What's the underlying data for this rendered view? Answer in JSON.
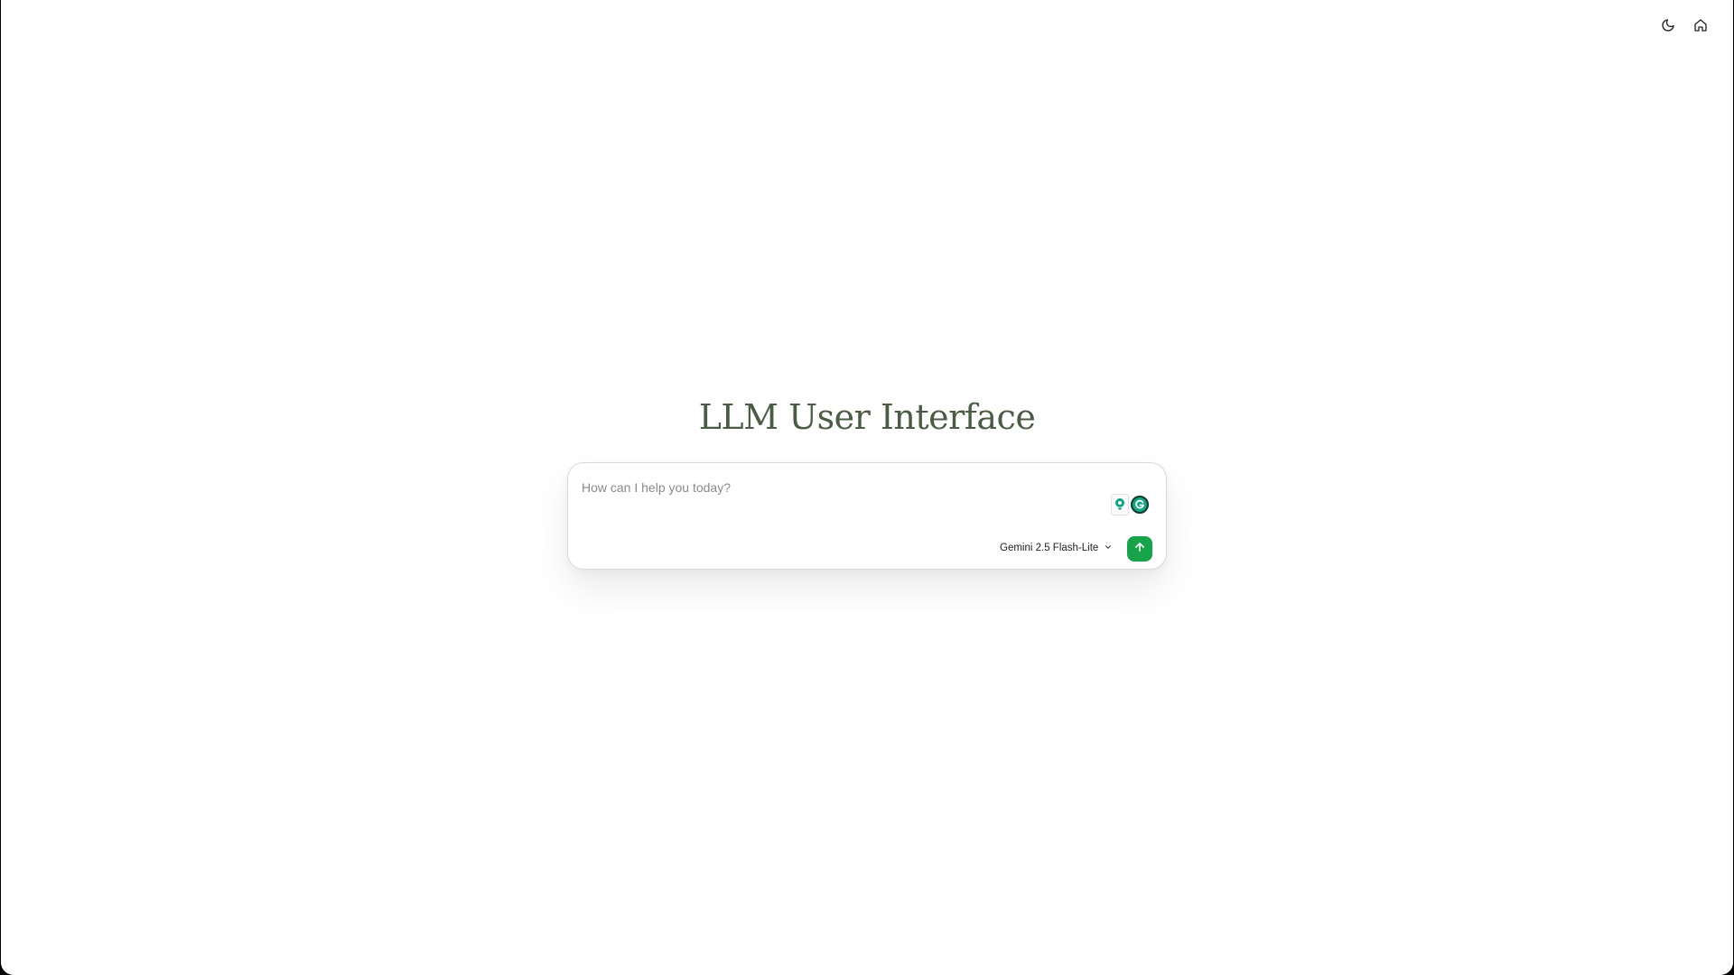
{
  "header": {
    "theme_toggle_icon": "moon-icon",
    "home_icon": "home-icon"
  },
  "main": {
    "title": "LLM User Interface"
  },
  "composer": {
    "placeholder": "How can I help you today?",
    "value": "",
    "model_label": "Gemini 2.5 Flash-Lite",
    "model_dropdown_icon": "chevron-down-icon",
    "send_icon": "arrow-up-icon",
    "extension_icons": [
      "lightbulb-icon",
      "grammarly-icon"
    ]
  },
  "colors": {
    "title": "#4a5d44",
    "send_button": "#16a34a",
    "extension_green": "#11a683"
  }
}
